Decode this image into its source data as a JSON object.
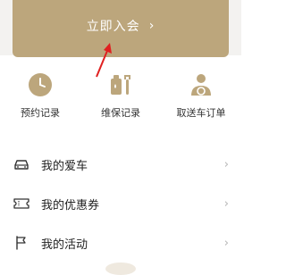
{
  "membership_banner": {
    "label": "立即入会",
    "chevron": "›"
  },
  "quick_actions": [
    {
      "label": "预约记录",
      "icon": "clock-icon"
    },
    {
      "label": "维保记录",
      "icon": "oil-wrench-icon"
    },
    {
      "label": "取送车订单",
      "icon": "driver-icon"
    }
  ],
  "menu": [
    {
      "label": "我的爱车",
      "icon": "car-icon"
    },
    {
      "label": "我的优惠券",
      "icon": "coupon-icon"
    },
    {
      "label": "我的活动",
      "icon": "flag-icon"
    }
  ],
  "menu_chevron": "›",
  "colors": {
    "accent_gold": "#bca67c",
    "annotation_red": "#e02020"
  }
}
